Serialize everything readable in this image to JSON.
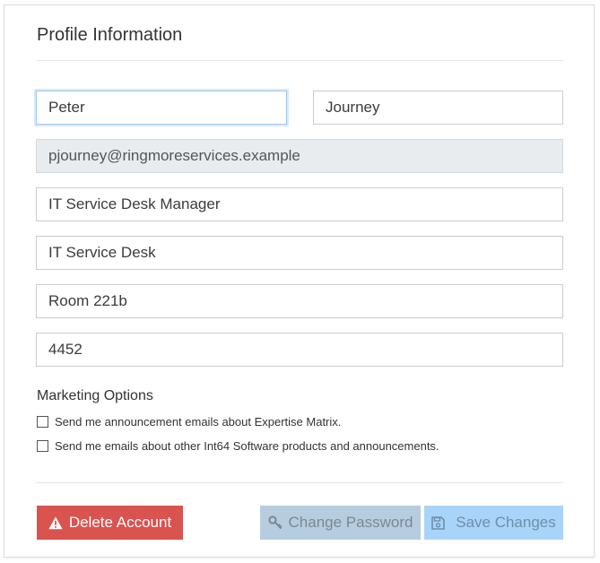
{
  "header": {
    "title": "Profile Information"
  },
  "form": {
    "first_name": "Peter",
    "last_name": "Journey",
    "email": "pjourney@ringmoreservices.example",
    "job_title": "IT Service Desk Manager",
    "department": "IT Service Desk",
    "location": "Room 221b",
    "extension": "4452"
  },
  "marketing": {
    "label": "Marketing Options",
    "option_1": "Send me announcement emails about Expertise Matrix.",
    "option_2": "Send me emails about other Int64 Software products and announcements."
  },
  "actions": {
    "delete_label": "Delete Account",
    "change_password_label": "Change Password",
    "save_label": "Save Changes"
  },
  "icons": {
    "delete": "warning-icon",
    "change_password": "key-icon",
    "save": "floppy-disk-icon"
  },
  "colors": {
    "danger": "#d9534f",
    "primary_disabled": "#a9d4fa",
    "secondary_disabled": "#b6cde0",
    "focus": "#9fc8ee"
  }
}
